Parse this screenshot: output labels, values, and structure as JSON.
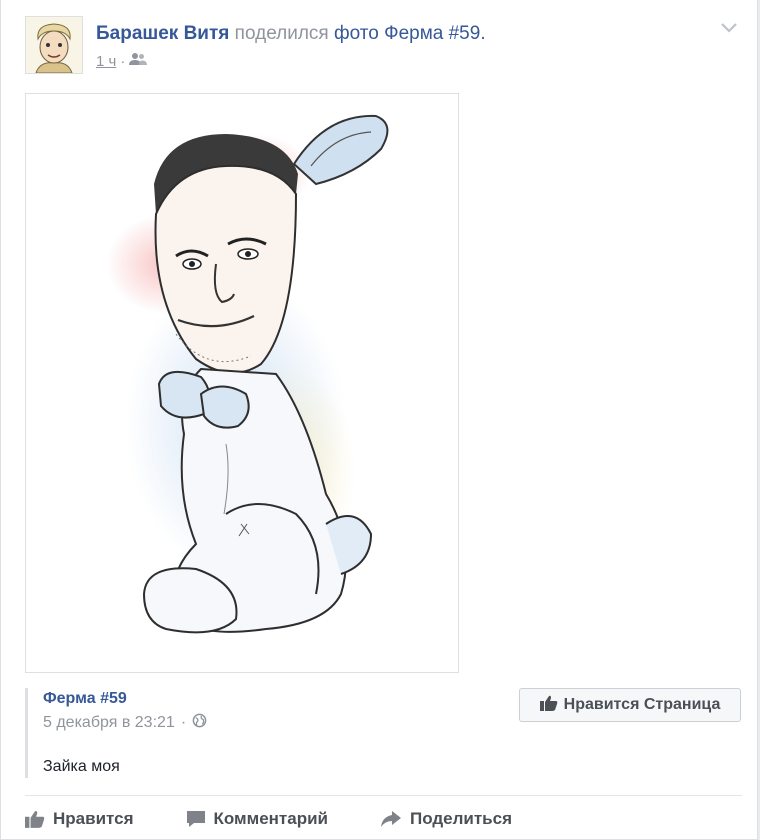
{
  "post": {
    "author": "Барашек Витя",
    "action": "поделился",
    "object": "фото",
    "target": "Ферма #59",
    "time": "1 ч",
    "audience_icon": "friends-icon",
    "menu_icon": "chevron-down-icon"
  },
  "shared": {
    "page_name": "Ферма #59",
    "date": "5 декабря в 23:21",
    "privacy_icon": "globe-icon",
    "text": "Зайка моя",
    "like_page_label": "Нравится Страница"
  },
  "actions": {
    "like": "Нравится",
    "comment": "Комментарий",
    "share": "Поделиться"
  },
  "colors": {
    "link": "#365899",
    "muted": "#90949c",
    "text": "#1d2129",
    "button_text": "#4b4f56"
  }
}
